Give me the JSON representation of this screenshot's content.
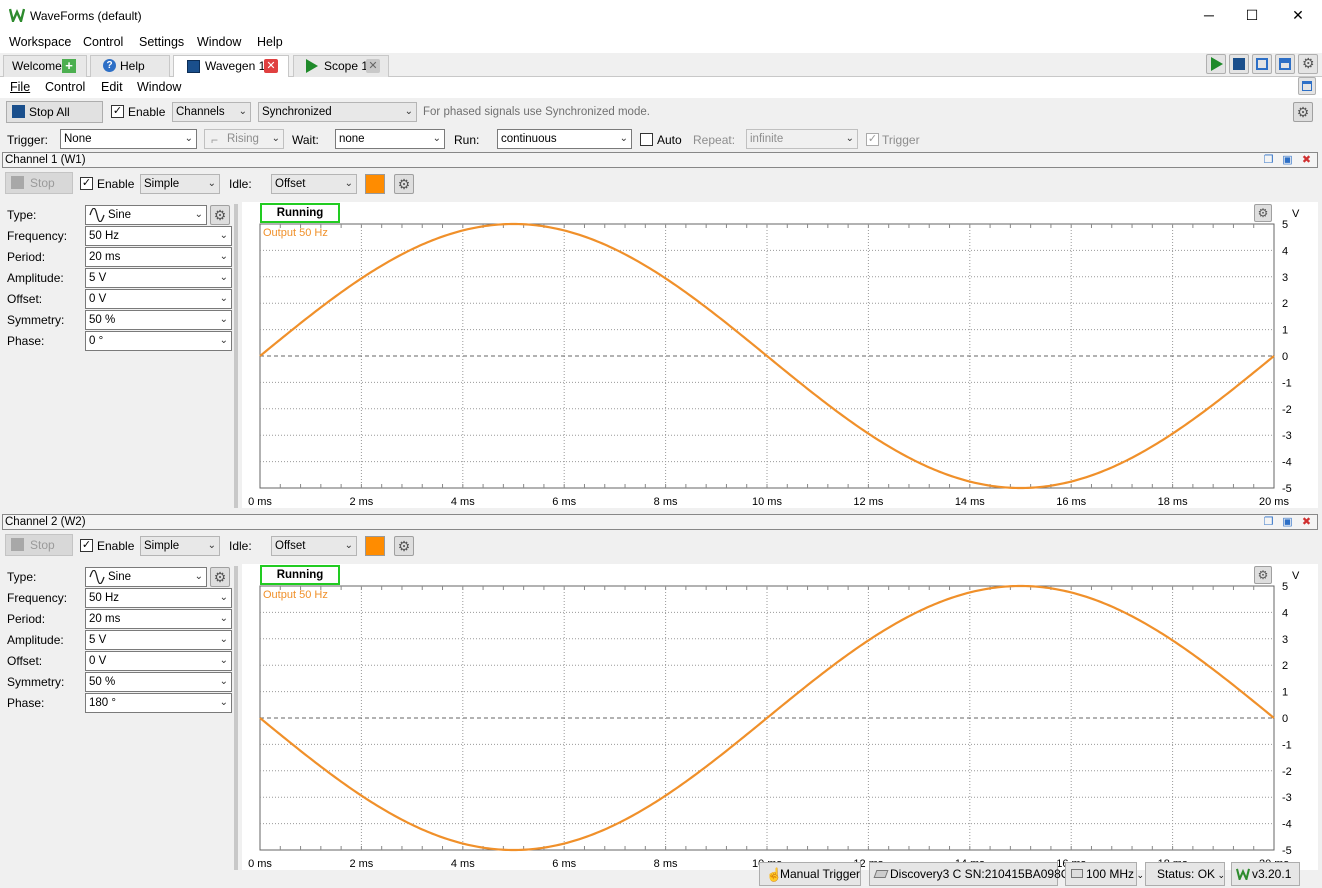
{
  "window": {
    "title": "WaveForms (default)",
    "minimize": "─",
    "maximize": "☐",
    "close": "✕"
  },
  "menu": [
    "Workspace",
    "Control",
    "Settings",
    "Window",
    "Help"
  ],
  "tabs": [
    {
      "label": "Welcome"
    },
    {
      "label": "Help"
    },
    {
      "label": "Wavegen 1"
    },
    {
      "label": "Scope 1"
    }
  ],
  "submenu": [
    "File",
    "Control",
    "Edit",
    "Window"
  ],
  "toolbar": {
    "stop_all": "Stop All",
    "enable": "Enable",
    "channels": "Channels",
    "mode": "Synchronized",
    "hint": "For phased signals use Synchronized mode."
  },
  "trigger_bar": {
    "trigger_label": "Trigger:",
    "trigger_value": "None",
    "edge": "Rising",
    "wait_label": "Wait:",
    "wait_value": "none",
    "run_label": "Run:",
    "run_value": "continuous",
    "auto": "Auto",
    "repeat_label": "Repeat:",
    "repeat_value": "infinite",
    "trigger_check": "Trigger"
  },
  "channels": [
    {
      "header": "Channel 1 (W1)",
      "stop": "Stop",
      "enable": "Enable",
      "mode": "Simple",
      "idle_label": "Idle:",
      "idle_value": "Offset",
      "params": [
        {
          "label": "Type:",
          "value": "Sine"
        },
        {
          "label": "Frequency:",
          "value": "50 Hz"
        },
        {
          "label": "Period:",
          "value": "20 ms"
        },
        {
          "label": "Amplitude:",
          "value": "5 V"
        },
        {
          "label": "Offset:",
          "value": "0 V"
        },
        {
          "label": "Symmetry:",
          "value": "50 %"
        },
        {
          "label": "Phase:",
          "value": "0 °"
        }
      ],
      "state": "Running",
      "legend": "Output 50 Hz",
      "unit": "V"
    },
    {
      "header": "Channel 2 (W2)",
      "stop": "Stop",
      "enable": "Enable",
      "mode": "Simple",
      "idle_label": "Idle:",
      "idle_value": "Offset",
      "params": [
        {
          "label": "Type:",
          "value": "Sine"
        },
        {
          "label": "Frequency:",
          "value": "50 Hz"
        },
        {
          "label": "Period:",
          "value": "20 ms"
        },
        {
          "label": "Amplitude:",
          "value": "5 V"
        },
        {
          "label": "Offset:",
          "value": "0 V"
        },
        {
          "label": "Symmetry:",
          "value": "50 %"
        },
        {
          "label": "Phase:",
          "value": "180 °"
        }
      ],
      "state": "Running",
      "legend": "Output 50 Hz",
      "unit": "V"
    }
  ],
  "statusbar": {
    "manual_trigger": "Manual Trigger",
    "device": "Discovery3 C SN:210415BA098C",
    "clock": "100 MHz",
    "status": "Status: OK",
    "version": "v3.20.1"
  },
  "colors": {
    "trace": "#f0902a",
    "running_border": "#22cc22",
    "idle_swatch": "#ff8c00"
  },
  "chart_data": [
    {
      "type": "line",
      "x_ticks": [
        "0 ms",
        "2 ms",
        "4 ms",
        "6 ms",
        "8 ms",
        "10 ms",
        "12 ms",
        "14 ms",
        "16 ms",
        "18 ms",
        "20 ms"
      ],
      "y_ticks": [
        "5",
        "4",
        "3",
        "2",
        "1",
        "0",
        "-1",
        "-2",
        "-3",
        "-4",
        "-5"
      ],
      "xlim": [
        0,
        20
      ],
      "ylim": [
        -5,
        5
      ],
      "grid": true,
      "series": [
        {
          "name": "Output 50 Hz",
          "amplitude": 5,
          "frequency_hz": 50,
          "phase_deg": 0
        }
      ]
    },
    {
      "type": "line",
      "x_ticks": [
        "0 ms",
        "2 ms",
        "4 ms",
        "6 ms",
        "8 ms",
        "10 ms",
        "12 ms",
        "14 ms",
        "16 ms",
        "18 ms",
        "20 ms"
      ],
      "y_ticks": [
        "5",
        "4",
        "3",
        "2",
        "1",
        "0",
        "-1",
        "-2",
        "-3",
        "-4",
        "-5"
      ],
      "xlim": [
        0,
        20
      ],
      "ylim": [
        -5,
        5
      ],
      "grid": true,
      "series": [
        {
          "name": "Output 50 Hz",
          "amplitude": 5,
          "frequency_hz": 50,
          "phase_deg": 180
        }
      ]
    }
  ]
}
